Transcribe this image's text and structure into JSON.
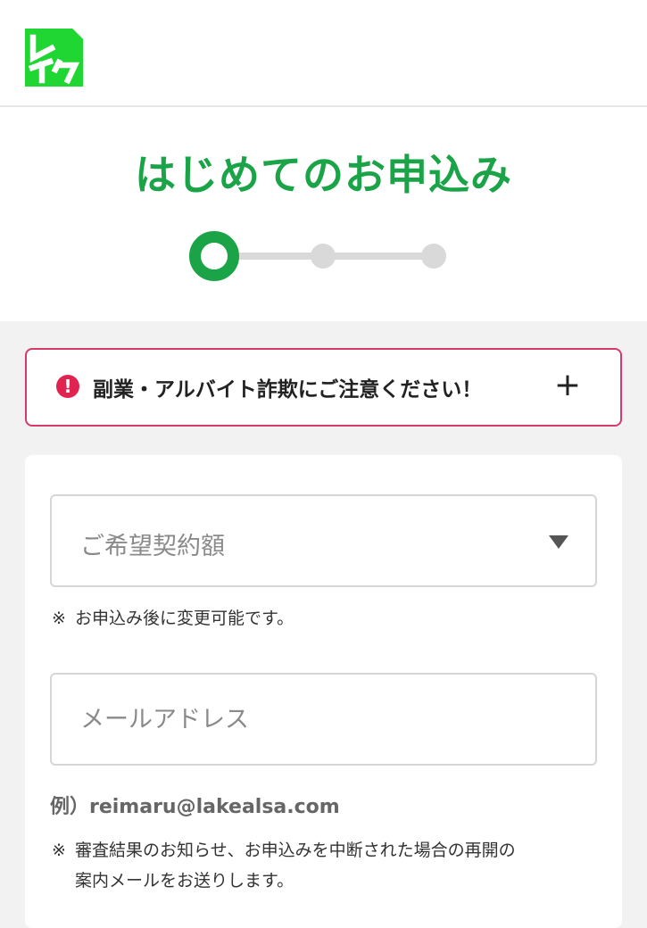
{
  "header": {
    "logo_text": "レイク",
    "brand_color": "#20d633"
  },
  "page": {
    "title": "はじめてのお申込み",
    "title_color": "#1aa347",
    "stepper": {
      "current_step": 1,
      "total_steps": 3
    }
  },
  "alert": {
    "icon": "exclamation-circle-icon",
    "icon_glyph": "!",
    "text": "副業・アルバイト詐欺にご注意ください！",
    "toggle": "+",
    "border_color": "#d63a6b"
  },
  "form": {
    "amount_select": {
      "placeholder": "ご希望契約額",
      "caret_icon": "triangle-down-icon"
    },
    "amount_note": {
      "mark": "※",
      "text": "お申込み後に変更可能です。"
    },
    "email": {
      "placeholder": "メールアドレス",
      "value": ""
    },
    "email_example": "例）reimaru@lakealsa.com",
    "email_note": {
      "mark": "※",
      "line1": "審査結果のお知らせ、お申込みを中断された場合の再開の",
      "line2": "案内メールをお送りします。"
    }
  }
}
